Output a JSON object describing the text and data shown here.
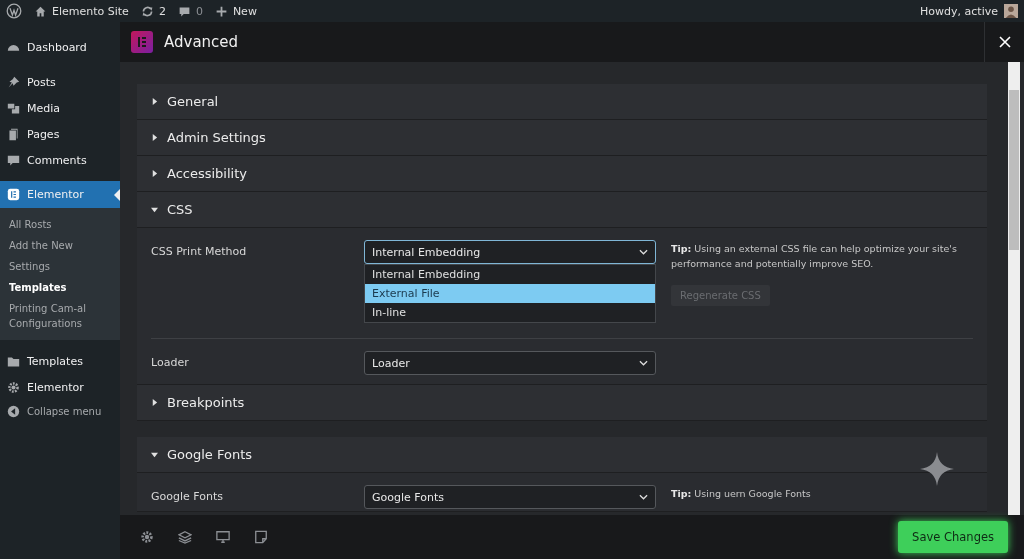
{
  "admin_bar": {
    "items": [
      {
        "kind": "logo"
      },
      {
        "kind": "site",
        "label": "Elemento Site"
      },
      {
        "kind": "updates",
        "label": "2"
      },
      {
        "kind": "comments",
        "label": "0"
      },
      {
        "kind": "new",
        "label": "New"
      }
    ],
    "greeting": "Howdy, active"
  },
  "sidebar": {
    "items": [
      {
        "kind": "dashboard",
        "label": "Dashboard",
        "selected": false
      },
      {
        "kind": "posts",
        "label": "Posts",
        "selected": false
      },
      {
        "kind": "media",
        "label": "Media",
        "selected": false
      },
      {
        "kind": "pages",
        "label": "Pages",
        "selected": false
      },
      {
        "kind": "comments",
        "label": "Comments",
        "selected": false
      },
      {
        "kind": "elementor",
        "label": "Elementor",
        "selected": true,
        "children": [
          {
            "label": "All Rosts",
            "selected": false
          },
          {
            "label": "Add the New",
            "selected": false
          },
          {
            "label": "Settings",
            "selected": false
          },
          {
            "label": "Templates",
            "selected": true
          },
          {
            "label": "Printing Cam-al Configurations",
            "selected": false
          }
        ]
      },
      {
        "kind": "templates",
        "label": "Templates",
        "selected": false
      },
      {
        "kind": "settings",
        "label": "Elementor",
        "selected": false
      },
      {
        "kind": "collapse",
        "label": "Collapse menu",
        "selected": false
      }
    ]
  },
  "modal": {
    "title": "Advanced",
    "sections": [
      {
        "title": "General",
        "expanded": false
      },
      {
        "title": "Admin Settings",
        "expanded": false
      },
      {
        "title": "Accessibility",
        "expanded": false
      },
      {
        "title": "CSS",
        "expanded": true,
        "fields": [
          {
            "label": "CSS Print Method",
            "value": "Internal Embedding",
            "open": true,
            "options": [
              {
                "label": "Internal Embedding",
                "highlighted": false
              },
              {
                "label": "External File",
                "highlighted": true
              },
              {
                "label": "In-line",
                "highlighted": false
              }
            ],
            "tip": "**Tip:** Using an external CSS file can help optimize your site's performance and potentially improve SEO.",
            "button": {
              "label": "Regenerate CSS",
              "disabled": true
            }
          },
          {
            "label": "Loader",
            "value": "Loader",
            "open": false
          }
        ]
      },
      {
        "title": "Breakpoints",
        "expanded": false
      },
      {
        "title": "Google Fonts",
        "expanded": true,
        "fields": [
          {
            "label": "Google Fonts",
            "value": "Google Fonts",
            "open": false,
            "tip": "**Tip:** Using uern Google Fonts"
          }
        ]
      }
    ]
  },
  "footer": {
    "tools": [
      {
        "kind": "settings"
      },
      {
        "kind": "layers"
      },
      {
        "kind": "desktop"
      },
      {
        "kind": "page"
      }
    ],
    "save_button": "Save Changes"
  }
}
